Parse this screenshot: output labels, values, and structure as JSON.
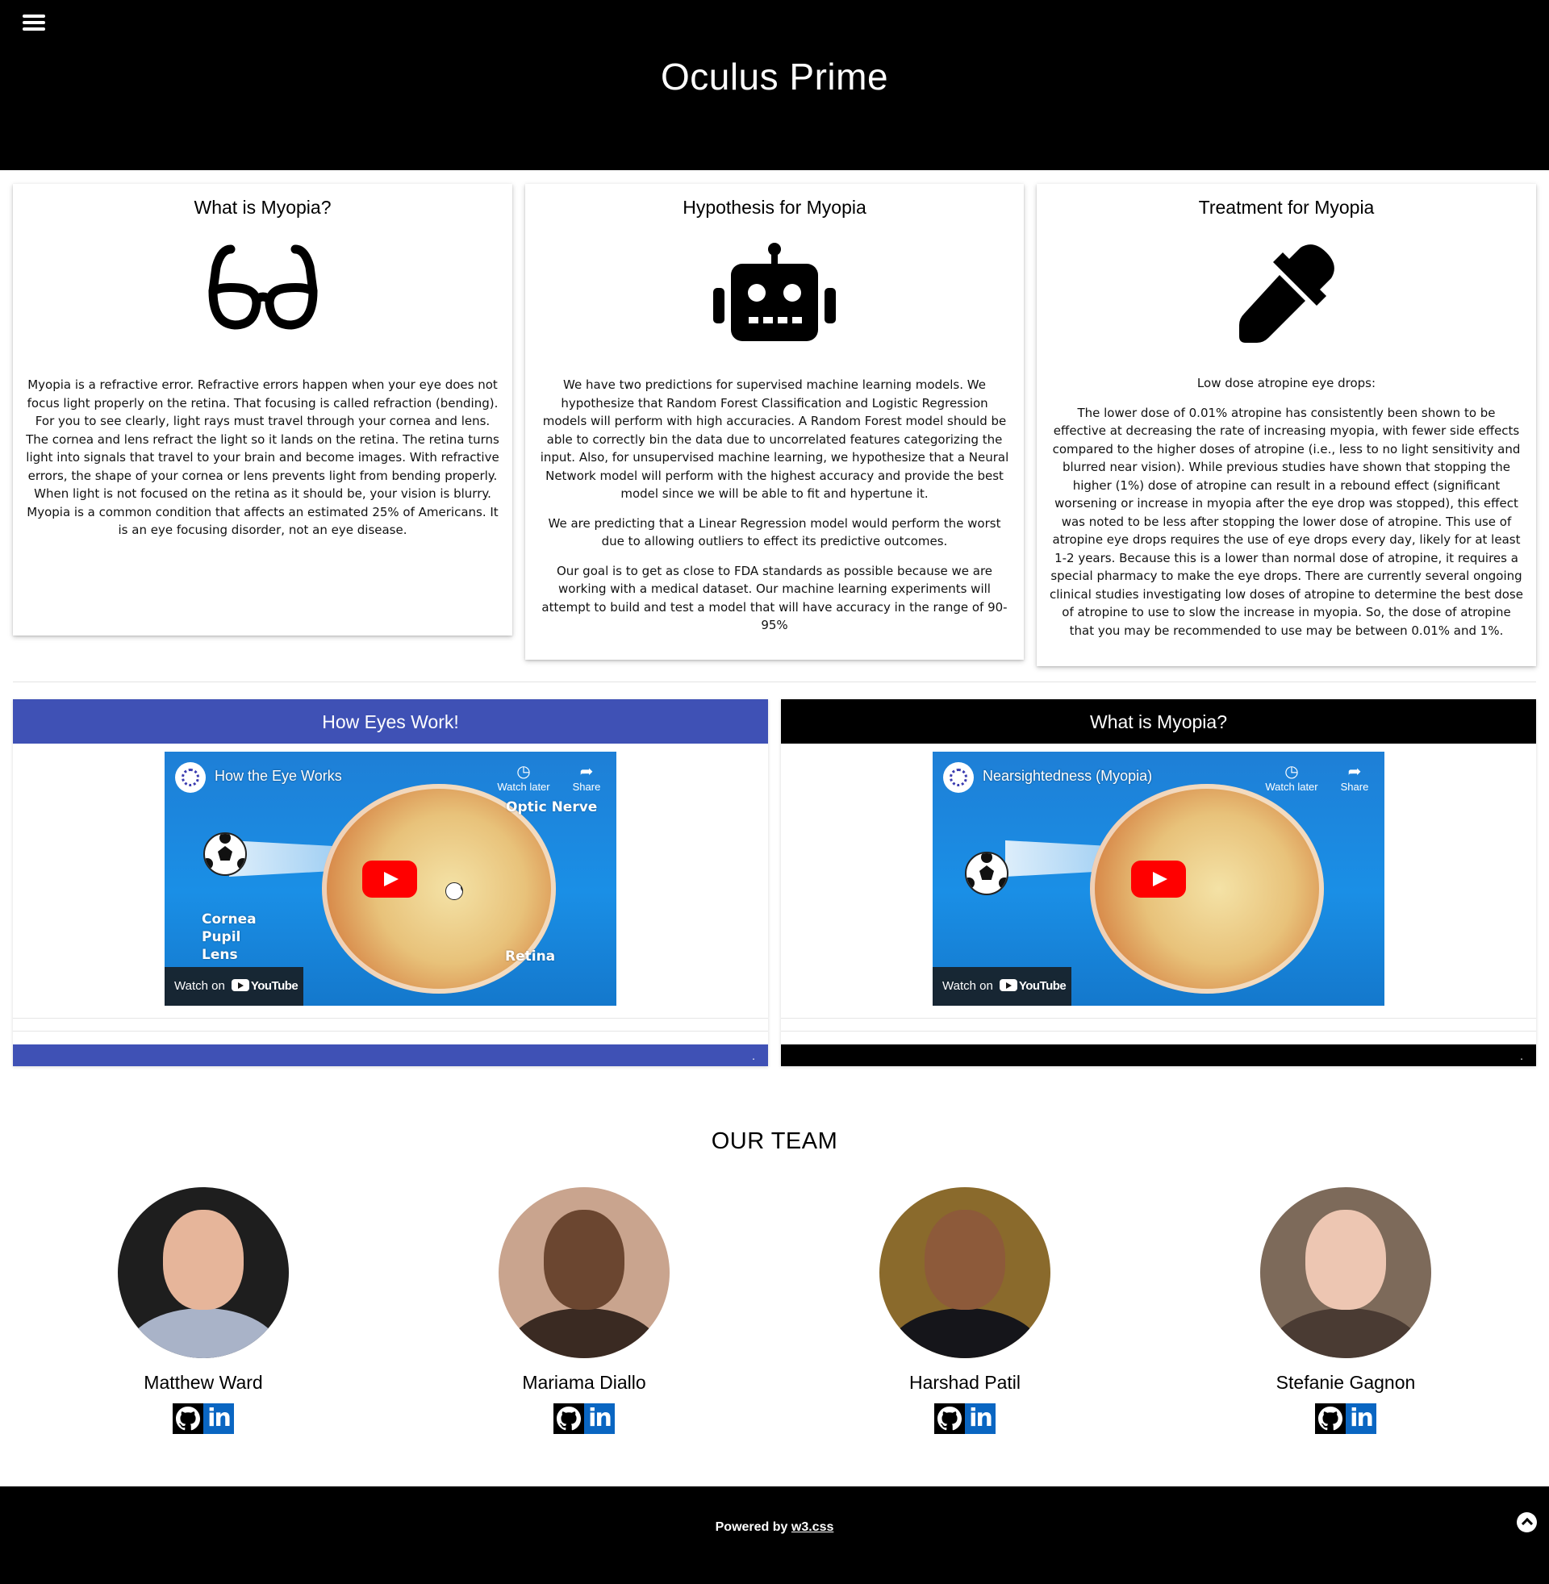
{
  "header": {
    "title": "Oculus Prime",
    "menu_icon": "hamburger-menu-icon"
  },
  "cards": [
    {
      "title": "What is Myopia?",
      "icon": "glasses-icon",
      "paragraphs": [
        "Myopia is a refractive error. Refractive errors happen when your eye does not focus light properly on the retina. That focusing is called refraction (bending). For you to see clearly, light rays must travel through your cornea and lens. The cornea and lens refract the light so it lands on the retina. The retina turns light into signals that travel to your brain and become images. With refractive errors, the shape of your cornea or lens prevents light from bending properly. When light is not focused on the retina as it should be, your vision is blurry. Myopia is a common condition that affects an estimated 25% of Americans. It is an eye focusing disorder, not an eye disease."
      ]
    },
    {
      "title": "Hypothesis for Myopia",
      "icon": "robot-icon",
      "paragraphs": [
        "We have two predictions for supervised machine learning models. We hypothesize that Random Forest Classification and Logistic Regression models will perform with high accuracies. A Random Forest model should be able to correctly bin the data due to uncorrelated features categorizing the input. Also, for unsupervised machine learning, we hypothesize that a Neural Network model will perform with the highest accuracy and provide the best model since we will be able to fit and hypertune it.",
        "We are predicting that a Linear Regression model would perform the worst due to allowing outliers to effect its predictive outcomes.",
        "Our goal is to get as close to FDA standards as possible because we are working with a medical dataset. Our machine learning experiments will attempt to build and test a model that will have accuracy in the range of 90-95%"
      ]
    },
    {
      "title": "Treatment for Myopia",
      "icon": "eyedropper-icon",
      "paragraphs": [
        "Low dose atropine eye drops:",
        "The lower dose of 0.01% atropine has consistently been shown to be effective at decreasing the rate of increasing myopia, with fewer side effects compared to the higher doses of atropine (i.e., less to no light sensitivity and blurred near vision). While previous studies have shown that stopping the higher (1%) dose of atropine can result in a rebound effect (significant worsening or increase in myopia after the eye drop was stopped), this effect was noted to be less after stopping the lower dose of atropine. This use of atropine eye drops requires the use of eye drops every day, likely for at least 1-2 years. Because this is a lower than normal dose of atropine, it requires a special pharmacy to make the eye drops. There are currently several ongoing clinical studies investigating low doses of atropine to determine the best dose of atropine to use to slow the increase in myopia. So, the dose of atropine that you may be recommended to use may be between 0.01% and 1%."
      ]
    }
  ],
  "videos": [
    {
      "heading": "How Eyes Work!",
      "video_title": "How the Eye Works",
      "watch_later": "Watch later",
      "share": "Share",
      "watch_on": "Watch on",
      "youtube": "YouTube",
      "labels": {
        "optic_nerve": "Optic Nerve",
        "cornea": "Cornea",
        "pupil": "Pupil",
        "lens": "Lens",
        "retina": "Retina"
      },
      "footer_mark": ".",
      "accent": "#3f51b5"
    },
    {
      "heading": "What is Myopia?",
      "video_title": "Nearsightedness (Myopia)",
      "watch_later": "Watch later",
      "share": "Share",
      "watch_on": "Watch on",
      "youtube": "YouTube",
      "footer_mark": ".",
      "accent": "#000000"
    }
  ],
  "team": {
    "title": "OUR TEAM",
    "members": [
      {
        "name": "Matthew Ward",
        "github_icon": "github-icon",
        "linkedin_label": "in"
      },
      {
        "name": "Mariama Diallo",
        "github_icon": "github-icon",
        "linkedin_label": "in"
      },
      {
        "name": "Harshad Patil",
        "github_icon": "github-icon",
        "linkedin_label": "in"
      },
      {
        "name": "Stefanie Gagnon",
        "github_icon": "github-icon",
        "linkedin_label": "in"
      }
    ]
  },
  "footer": {
    "powered_prefix": "Powered by",
    "powered_link": "w3.css",
    "to_top_icon": "chevron-up-icon"
  }
}
